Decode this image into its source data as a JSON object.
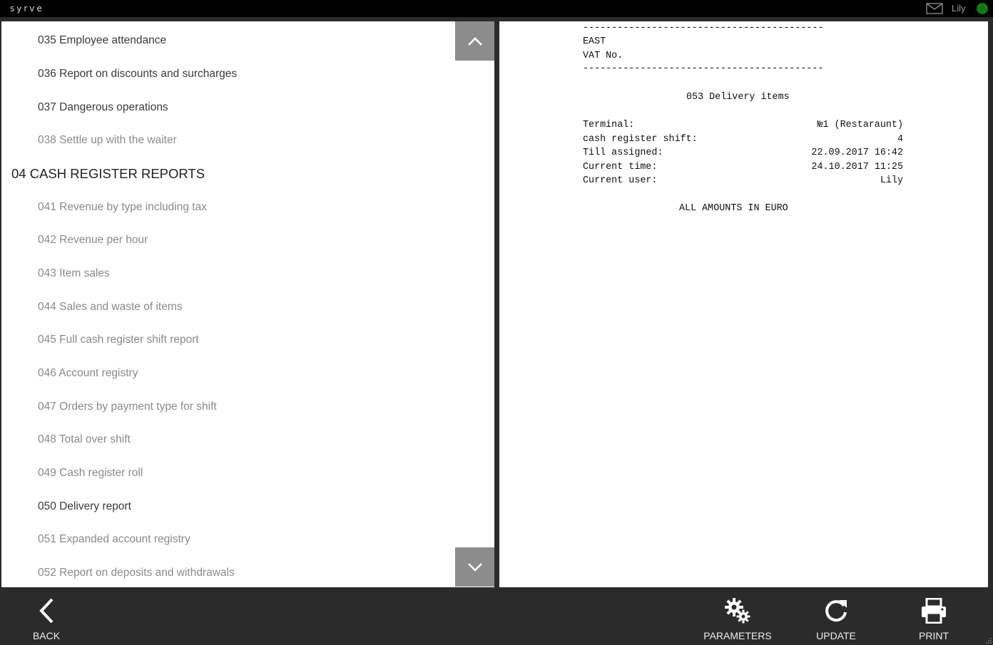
{
  "app": {
    "brand": "syrve",
    "user": "Lily",
    "colors": {
      "topbar": "#000000",
      "frame": "#2b2b2b",
      "status_online": "#127a12",
      "scroll_button": "#8c8c8c"
    }
  },
  "report_list": {
    "items_top": [
      {
        "label": "035 Employee attendance",
        "style": "dark"
      },
      {
        "label": "036 Report on discounts and surcharges",
        "style": "dark"
      },
      {
        "label": "037 Dangerous operations",
        "style": "dark"
      },
      {
        "label": "038 Settle up with the waiter",
        "style": "light"
      }
    ],
    "section": "04 CASH REGISTER REPORTS",
    "items": [
      {
        "label": "041 Revenue by type including tax",
        "style": "light"
      },
      {
        "label": "042 Revenue per hour",
        "style": "light"
      },
      {
        "label": "043 Item sales",
        "style": "light"
      },
      {
        "label": "044 Sales and waste of items",
        "style": "light"
      },
      {
        "label": "045 Full cash register shift report",
        "style": "light"
      },
      {
        "label": "046 Account registry",
        "style": "light"
      },
      {
        "label": "047 Orders by payment type for shift",
        "style": "light"
      },
      {
        "label": "048 Total over shift",
        "style": "light"
      },
      {
        "label": "049 Cash register roll",
        "style": "light"
      },
      {
        "label": "050 Delivery report",
        "style": "dark"
      },
      {
        "label": "051 Expanded account registry",
        "style": "light"
      },
      {
        "label": "052 Report on deposits and withdrawals",
        "style": "light"
      }
    ]
  },
  "report": {
    "separator": "------------------------------------------",
    "store": "EAST",
    "vat": "VAT No.",
    "title": "053 Delivery items",
    "fields": [
      {
        "label": "Terminal:",
        "value": "№1 (Restaraunt)"
      },
      {
        "label": "cash register shift:",
        "value": "4"
      },
      {
        "label": "Till assigned:",
        "value": "22.09.2017 16:42"
      },
      {
        "label": "Current time:",
        "value": "24.10.2017 11:25"
      },
      {
        "label": "Current user:",
        "value": "Lily"
      }
    ],
    "currency_note": "ALL AMOUNTS IN EURO"
  },
  "toolbar": {
    "back": "BACK",
    "parameters": "PARAMETERS",
    "update": "UPDATE",
    "print": "PRINT"
  }
}
